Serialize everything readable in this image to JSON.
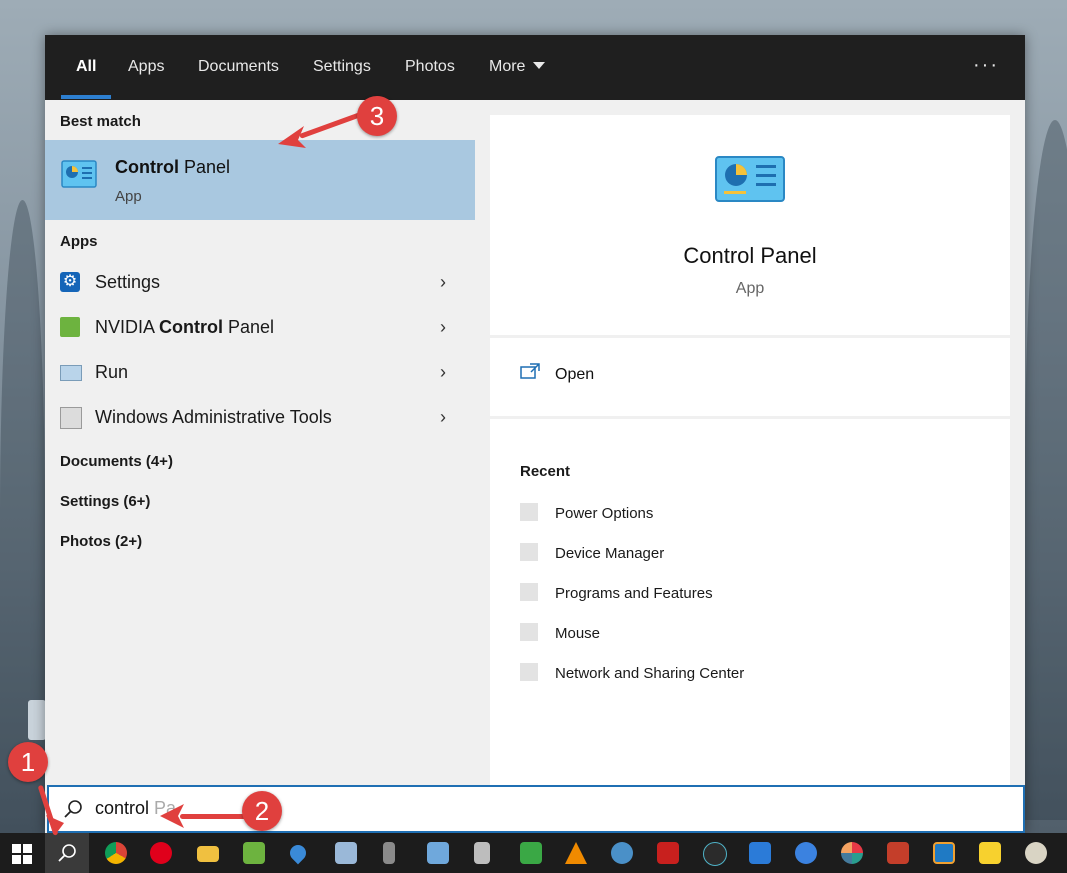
{
  "tabs": [
    {
      "label": "All"
    },
    {
      "label": "Apps"
    },
    {
      "label": "Documents"
    },
    {
      "label": "Settings"
    },
    {
      "label": "Photos"
    },
    {
      "label": "More"
    }
  ],
  "tabs_overflow": "···",
  "best_match": {
    "header": "Best match",
    "title_bold": "Control",
    "title_rest": " Panel",
    "subtitle": "App"
  },
  "apps": {
    "header": "Apps",
    "items": [
      {
        "label_pre": "Settings",
        "label_bold": "",
        "label_post": "",
        "icon": "settings-gear-icon"
      },
      {
        "label_pre": "NVIDIA ",
        "label_bold": "Control",
        "label_post": " Panel",
        "icon": "nvidia-icon"
      },
      {
        "label_pre": "Run",
        "label_bold": "",
        "label_post": "",
        "icon": "run-icon"
      },
      {
        "label_pre": "Windows Administrative Tools",
        "label_bold": "",
        "label_post": "",
        "icon": "admin-tools-icon"
      }
    ]
  },
  "categories": [
    {
      "label": "Documents (4+)"
    },
    {
      "label": "Settings (6+)"
    },
    {
      "label": "Photos (2+)"
    }
  ],
  "detail": {
    "title": "Control Panel",
    "subtitle": "App",
    "open_label": "Open",
    "recent_header": "Recent",
    "recent": [
      {
        "label": "Power Options"
      },
      {
        "label": "Device Manager"
      },
      {
        "label": "Programs and Features"
      },
      {
        "label": "Mouse"
      },
      {
        "label": "Network and Sharing Center"
      }
    ]
  },
  "search": {
    "value": "control",
    "suggestion": " Pa"
  },
  "annotations": [
    {
      "label": "1"
    },
    {
      "label": "2"
    },
    {
      "label": "3"
    }
  ],
  "colors": {
    "accent": "#1f6fb3",
    "selected_row": "#a9c8e0",
    "annotation_red": "#e0403e"
  }
}
